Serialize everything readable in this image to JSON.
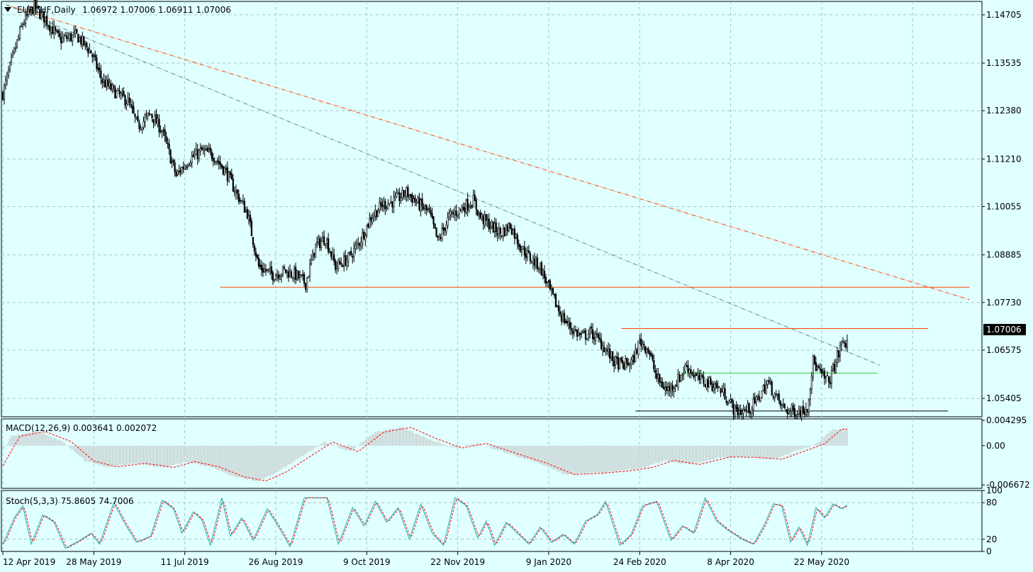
{
  "window": {
    "symbol_label": "EURCHF,Daily",
    "ohlc_text": "1.06972 1.07006 1.06911 1.07006"
  },
  "indicators": {
    "macd_label": "MACD(12,26,9) 0.003641 0.002072",
    "stoch_label": "Stoch(5,3,3) 75.8605 74.7006"
  },
  "colors": {
    "background": "#e0ffff",
    "candle": "#000000",
    "trendline_red": "#ff4500",
    "trendline_gray": "#708090",
    "support_green": "#32cd32",
    "support_black": "#000000",
    "macd_signal": "#ff0000",
    "macd_hist": "#c0c0c0",
    "stoch_main": "#20b2aa",
    "stoch_signal": "#ff0000",
    "price_tag_bg": "#000000",
    "price_tag_text": "#ffffff"
  },
  "chart_data": [
    {
      "type": "candlestick",
      "title": "EURCHF,Daily",
      "x_ticks": [
        "12 Apr 2019",
        "28 May 2019",
        "11 Jul 2019",
        "26 Aug 2019",
        "9 Oct 2019",
        "22 Nov 2019",
        "9 Jan 2020",
        "24 Feb 2020",
        "8 Apr 2020",
        "22 May 2020"
      ],
      "y_ticks": [
        "1.14705",
        "1.13535",
        "1.12380",
        "1.11210",
        "1.10055",
        "1.08885",
        "1.07730",
        "1.06575",
        "1.05405"
      ],
      "y_tick_values": [
        1.14705,
        1.13535,
        1.1238,
        1.1121,
        1.10055,
        1.08885,
        1.0773,
        1.06575,
        1.05405
      ],
      "ylim": [
        1.0496,
        1.1503
      ],
      "current_price": "1.07006",
      "grid": true,
      "path_anchors": [
        [
          0,
          1.128
        ],
        [
          8,
          1.138
        ],
        [
          14,
          1.145
        ],
        [
          22,
          1.149
        ],
        [
          30,
          1.146
        ],
        [
          40,
          1.141
        ],
        [
          52,
          1.142
        ],
        [
          62,
          1.138
        ],
        [
          70,
          1.131
        ],
        [
          80,
          1.128
        ],
        [
          88,
          1.126
        ],
        [
          95,
          1.12
        ],
        [
          104,
          1.123
        ],
        [
          112,
          1.119
        ],
        [
          122,
          1.108
        ],
        [
          131,
          1.112
        ],
        [
          140,
          1.114
        ],
        [
          148,
          1.113
        ],
        [
          157,
          1.109
        ],
        [
          164,
          1.104
        ],
        [
          172,
          1.099
        ],
        [
          180,
          1.086
        ],
        [
          190,
          1.084
        ],
        [
          198,
          1.085
        ],
        [
          206,
          1.084
        ],
        [
          213,
          1.082
        ],
        [
          220,
          1.091
        ],
        [
          227,
          1.093
        ],
        [
          234,
          1.086
        ],
        [
          243,
          1.088
        ],
        [
          251,
          1.092
        ],
        [
          259,
          1.098
        ],
        [
          267,
          1.101
        ],
        [
          276,
          1.102
        ],
        [
          284,
          1.104
        ],
        [
          293,
          1.101
        ],
        [
          300,
          1.099
        ],
        [
          306,
          1.092
        ],
        [
          314,
          1.098
        ],
        [
          322,
          1.1
        ],
        [
          331,
          1.102
        ],
        [
          336,
          1.098
        ],
        [
          343,
          1.096
        ],
        [
          350,
          1.094
        ],
        [
          357,
          1.096
        ],
        [
          364,
          1.091
        ],
        [
          371,
          1.088
        ],
        [
          378,
          1.086
        ],
        [
          385,
          1.08
        ],
        [
          393,
          1.074
        ],
        [
          400,
          1.071
        ],
        [
          407,
          1.069
        ],
        [
          414,
          1.07
        ],
        [
          422,
          1.067
        ],
        [
          430,
          1.063
        ],
        [
          436,
          1.062
        ],
        [
          443,
          1.063
        ],
        [
          448,
          1.068
        ],
        [
          454,
          1.066
        ],
        [
          460,
          1.059
        ],
        [
          467,
          1.056
        ],
        [
          474,
          1.058
        ],
        [
          481,
          1.062
        ],
        [
          488,
          1.059
        ],
        [
          495,
          1.058
        ],
        [
          502,
          1.057
        ],
        [
          508,
          1.055
        ],
        [
          515,
          1.051
        ],
        [
          522,
          1.051
        ],
        [
          527,
          1.052
        ],
        [
          533,
          1.055
        ],
        [
          538,
          1.058
        ],
        [
          543,
          1.055
        ],
        [
          548,
          1.052
        ],
        [
          553,
          1.051
        ],
        [
          558,
          1.051
        ],
        [
          562,
          1.051
        ],
        [
          566,
          1.052
        ],
        [
          570,
          1.063
        ],
        [
          575,
          1.06
        ],
        [
          581,
          1.058
        ],
        [
          586,
          1.063
        ],
        [
          591,
          1.068
        ],
        [
          594,
          1.067
        ]
      ],
      "overlay_lines": [
        {
          "name": "",
          "style": "dash-dot",
          "color_key": "trendline_red",
          "x": [
            2,
            680
          ],
          "y": [
            1.1495,
            1.078
          ]
        },
        {
          "name": "",
          "style": "dash-dot",
          "color_key": "trendline_gray",
          "x": [
            2,
            617
          ],
          "y": [
            1.1495,
            1.0621
          ]
        },
        {
          "name": "",
          "style": "solid",
          "color_key": "trendline_red",
          "x": [
            153,
            680
          ],
          "y": [
            1.081,
            1.081
          ]
        },
        {
          "name": "",
          "style": "solid",
          "color_key": "trendline_red",
          "x": [
            435,
            651
          ],
          "y": [
            1.071,
            1.071
          ]
        },
        {
          "name": "",
          "style": "solid",
          "color_key": "support_green",
          "x": [
            477,
            615
          ],
          "y": [
            1.0602,
            1.0602
          ]
        },
        {
          "name": "",
          "style": "solid",
          "color_key": "support_black",
          "x": [
            445,
            665
          ],
          "y": [
            1.051,
            1.051
          ]
        }
      ]
    },
    {
      "type": "line",
      "title": "MACD(12,26,9) 0.003641 0.002072",
      "y_ticks": [
        "0.004295",
        "0.00",
        "-0.006672"
      ],
      "y_tick_values": [
        0.004295,
        0.0,
        -0.006672
      ],
      "ylim": [
        -0.00725,
        0.00455
      ],
      "signal_anchors": [
        [
          0,
          -0.0034
        ],
        [
          12,
          0.0016
        ],
        [
          30,
          0.0024
        ],
        [
          48,
          0.0007
        ],
        [
          64,
          -0.0026
        ],
        [
          80,
          -0.0036
        ],
        [
          100,
          -0.003
        ],
        [
          120,
          -0.0037
        ],
        [
          135,
          -0.0027
        ],
        [
          152,
          -0.0036
        ],
        [
          170,
          -0.0053
        ],
        [
          185,
          -0.006
        ],
        [
          200,
          -0.0044
        ],
        [
          215,
          -0.002
        ],
        [
          232,
          0.0006
        ],
        [
          250,
          -0.001
        ],
        [
          268,
          0.0023
        ],
        [
          287,
          0.0031
        ],
        [
          305,
          0.0012
        ],
        [
          323,
          -0.0004
        ],
        [
          340,
          0.0004
        ],
        [
          360,
          -0.0012
        ],
        [
          383,
          -0.003
        ],
        [
          402,
          -0.0049
        ],
        [
          420,
          -0.0047
        ],
        [
          440,
          -0.0043
        ],
        [
          457,
          -0.0037
        ],
        [
          472,
          -0.0025
        ],
        [
          490,
          -0.0032
        ],
        [
          512,
          -0.0019
        ],
        [
          532,
          -0.002
        ],
        [
          548,
          -0.0023
        ],
        [
          563,
          -0.001
        ],
        [
          578,
          0.0003
        ],
        [
          590,
          0.0028
        ]
      ]
    },
    {
      "type": "line",
      "title": "Stoch(5,3,3) 75.8605 74.7006",
      "y_ticks": [
        "100",
        "80",
        "20",
        "0"
      ],
      "y_tick_values": [
        100,
        80,
        20,
        0
      ],
      "ylim": [
        0,
        100
      ],
      "main_anchors": [
        [
          0,
          12
        ],
        [
          8,
          55
        ],
        [
          14,
          75
        ],
        [
          20,
          12
        ],
        [
          28,
          60
        ],
        [
          36,
          48
        ],
        [
          44,
          5
        ],
        [
          54,
          18
        ],
        [
          62,
          30
        ],
        [
          68,
          12
        ],
        [
          78,
          80
        ],
        [
          86,
          45
        ],
        [
          94,
          15
        ],
        [
          104,
          25
        ],
        [
          112,
          84
        ],
        [
          120,
          70
        ],
        [
          126,
          30
        ],
        [
          134,
          65
        ],
        [
          140,
          52
        ],
        [
          146,
          10
        ],
        [
          154,
          88
        ],
        [
          160,
          25
        ],
        [
          168,
          55
        ],
        [
          176,
          18
        ],
        [
          186,
          70
        ],
        [
          194,
          40
        ],
        [
          202,
          8
        ],
        [
          212,
          88
        ],
        [
          228,
          88
        ],
        [
          236,
          12
        ],
        [
          246,
          72
        ],
        [
          254,
          42
        ],
        [
          262,
          82
        ],
        [
          270,
          48
        ],
        [
          278,
          72
        ],
        [
          286,
          20
        ],
        [
          294,
          78
        ],
        [
          302,
          30
        ],
        [
          310,
          10
        ],
        [
          318,
          88
        ],
        [
          326,
          75
        ],
        [
          334,
          22
        ],
        [
          340,
          50
        ],
        [
          346,
          10
        ],
        [
          354,
          48
        ],
        [
          362,
          30
        ],
        [
          370,
          12
        ],
        [
          378,
          40
        ],
        [
          386,
          15
        ],
        [
          394,
          28
        ],
        [
          402,
          12
        ],
        [
          410,
          50
        ],
        [
          418,
          60
        ],
        [
          424,
          82
        ],
        [
          434,
          10
        ],
        [
          442,
          28
        ],
        [
          450,
          75
        ],
        [
          460,
          82
        ],
        [
          470,
          18
        ],
        [
          478,
          42
        ],
        [
          486,
          30
        ],
        [
          494,
          88
        ],
        [
          502,
          50
        ],
        [
          510,
          35
        ],
        [
          520,
          20
        ],
        [
          528,
          12
        ],
        [
          536,
          45
        ],
        [
          542,
          78
        ],
        [
          548,
          75
        ],
        [
          554,
          15
        ],
        [
          560,
          40
        ],
        [
          566,
          10
        ],
        [
          572,
          72
        ],
        [
          578,
          55
        ],
        [
          584,
          78
        ],
        [
          590,
          70
        ],
        [
          594,
          76
        ]
      ]
    }
  ]
}
